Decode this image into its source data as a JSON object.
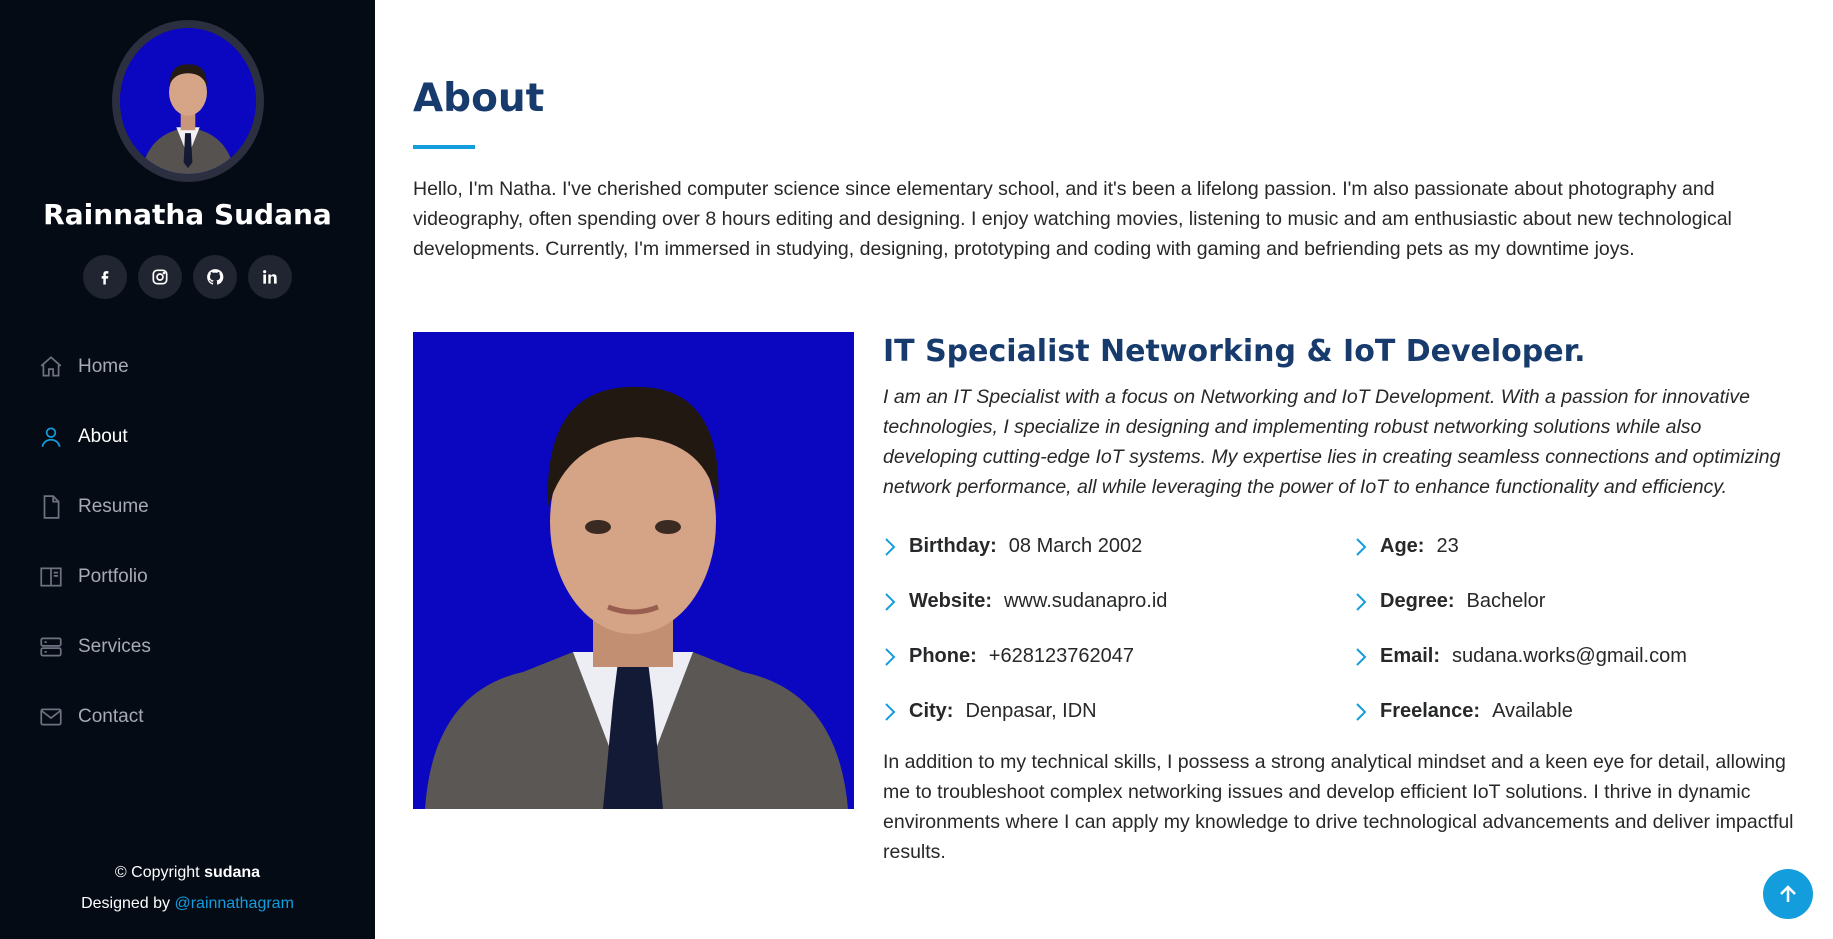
{
  "profile": {
    "name": "Rainnatha Sudana",
    "social": [
      "facebook-icon",
      "instagram-icon",
      "github-icon",
      "linkedin-icon"
    ]
  },
  "nav": {
    "items": [
      {
        "label": "Home",
        "icon": "home-icon"
      },
      {
        "label": "About",
        "icon": "person-icon",
        "active": true
      },
      {
        "label": "Resume",
        "icon": "file-icon"
      },
      {
        "label": "Portfolio",
        "icon": "book-icon"
      },
      {
        "label": "Services",
        "icon": "server-icon"
      },
      {
        "label": "Contact",
        "icon": "envelope-icon"
      }
    ]
  },
  "footer": {
    "copyright_prefix": "© Copyright ",
    "copyright_name": "sudana",
    "designed_prefix": "Designed by ",
    "designed_link": "@rainnathagram"
  },
  "about": {
    "title": "About",
    "intro": "Hello, I'm Natha. I've cherished computer science since elementary school, and it's been a lifelong passion. I'm also passionate about photography and videography, often spending over 8 hours editing and designing. I enjoy watching movies, listening to music and am enthusiastic about new technological developments. Currently, I'm immersed in studying, designing, prototyping and coding with gaming and befriending pets as my downtime joys.",
    "role": "IT Specialist Networking & IoT Developer.",
    "role_desc": "I am an IT Specialist with a focus on Networking and IoT Development. With a passion for innovative technologies, I specialize in designing and implementing robust networking solutions while also developing cutting-edge IoT systems. My expertise lies in creating seamless connections and optimizing network performance, all while leveraging the power of IoT to enhance functionality and efficiency.",
    "facts": [
      {
        "label": "Birthday:",
        "value": "08 March 2002"
      },
      {
        "label": "Age:",
        "value": "23"
      },
      {
        "label": "Website:",
        "value": "www.sudanapro.id"
      },
      {
        "label": "Degree:",
        "value": "Bachelor"
      },
      {
        "label": "Phone:",
        "value": "+628123762047"
      },
      {
        "label": "Email:",
        "value": "sudana.works@gmail.com"
      },
      {
        "label": "City:",
        "value": "Denpasar, IDN"
      },
      {
        "label": "Freelance:",
        "value": "Available"
      }
    ],
    "outro": "In addition to my technical skills, I possess a strong analytical mindset and a keen eye for detail, allowing me to troubleshoot complex networking issues and develop efficient IoT solutions. I thrive in dynamic environments where I can apply my knowledge to drive technological advancements and deliver impactful results."
  },
  "colors": {
    "sidebar_bg": "#040b14",
    "accent": "#149ddd",
    "heading": "#173b6c",
    "photo_bg": "#0b06c0"
  }
}
